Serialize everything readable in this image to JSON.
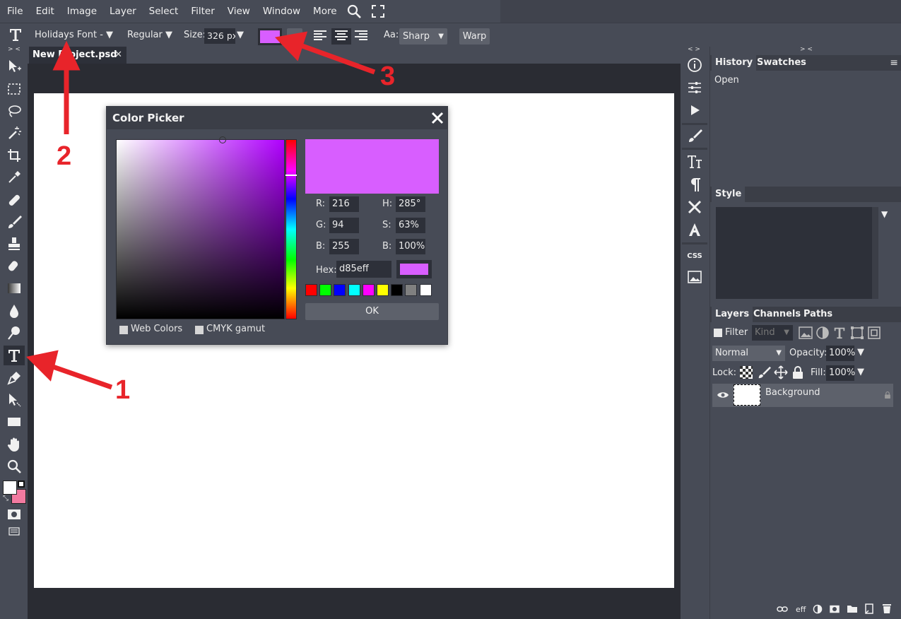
{
  "menu": [
    "File",
    "Edit",
    "Image",
    "Layer",
    "Select",
    "Filter",
    "View",
    "Window",
    "More"
  ],
  "options": {
    "font_family": "Holidays Font -",
    "font_style": "Regular",
    "size_label": "Size:",
    "size_value": "326 px",
    "antialias_label": "Aa:",
    "antialias_value": "Sharp",
    "warp_label": "Warp",
    "text_color": "#d85eff"
  },
  "document": {
    "tab_title": "New Project.psd",
    "close_glyph": "✕"
  },
  "color_picker": {
    "title": "Color Picker",
    "r_label": "R:",
    "r": "216",
    "g_label": "G:",
    "g": "94",
    "b_label": "B:",
    "b": "255",
    "h_label": "H:",
    "h": "285°",
    "s_label": "S:",
    "s": "63%",
    "br_label": "B:",
    "br": "100%",
    "hex_label": "Hex:",
    "hex": "d85eff",
    "ok_label": "OK",
    "web_colors_label": "Web Colors",
    "cmyk_label": "CMYK gamut",
    "swatches": [
      "#ff0000",
      "#00ff00",
      "#0000ff",
      "#00ffff",
      "#ff00ff",
      "#ffff00",
      "#000000",
      "#808080",
      "#ffffff"
    ],
    "selected_color": "#d85eff",
    "hue_color": "#b000ff"
  },
  "history_panel": {
    "tabs": [
      "History",
      "Swatches"
    ],
    "items": [
      "Open"
    ]
  },
  "style_panel": {
    "tabs": [
      "Style"
    ]
  },
  "layers_panel": {
    "tabs": [
      "Layers",
      "Channels",
      "Paths"
    ],
    "filter_label": "Filter",
    "kind_placeholder": "Kind",
    "blend_mode": "Normal",
    "opacity_label": "Opacity:",
    "opacity_value": "100%",
    "lock_label": "Lock:",
    "fill_label": "Fill:",
    "fill_value": "100%",
    "layers": [
      {
        "name": "Background"
      }
    ],
    "footer_eff": "eff"
  },
  "right_strip": {
    "css_label": "CSS"
  },
  "annotations": [
    "1",
    "2",
    "3"
  ],
  "colors": {
    "foreground": "#ffffff",
    "background": "#f27aa0",
    "arrow": "#e8242a"
  }
}
